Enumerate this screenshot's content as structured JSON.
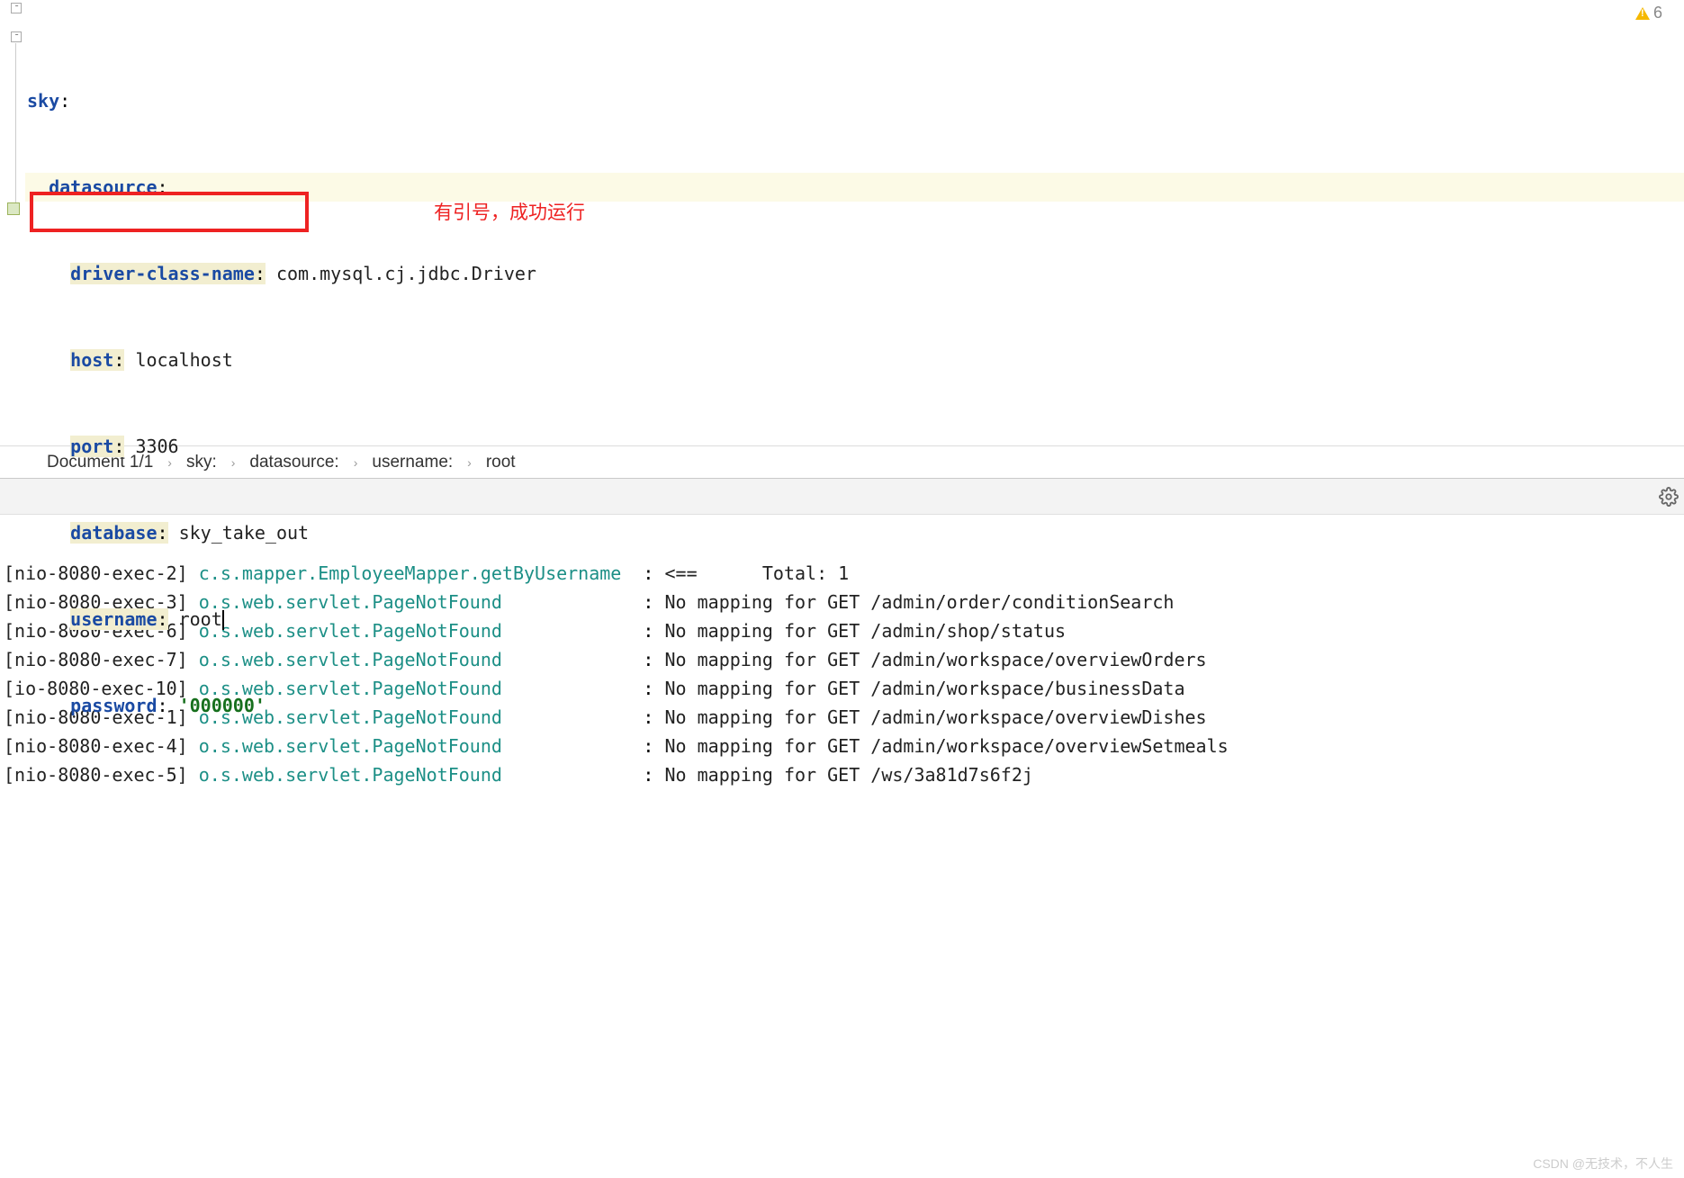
{
  "warning": {
    "count": "6"
  },
  "yaml": {
    "l1": {
      "key": "sky",
      "indent": ""
    },
    "l2": {
      "key": "datasource",
      "indent": "  "
    },
    "l3": {
      "key": "driver-class-name",
      "val": "com.mysql.cj.jdbc.Driver",
      "indent": "    "
    },
    "l4": {
      "key": "host",
      "val": "localhost",
      "indent": "    "
    },
    "l5": {
      "key": "port",
      "val": "3306",
      "indent": "    "
    },
    "l6": {
      "key": "database",
      "val": "sky_take_out",
      "indent": "    "
    },
    "l7": {
      "key": "username",
      "val": "root",
      "indent": "    "
    },
    "l8": {
      "key": "password",
      "val": "'000000'",
      "indent": "    "
    }
  },
  "annotation": "有引号，成功运行",
  "breadcrumb": {
    "doc": "Document 1/1",
    "p1": "sky:",
    "p2": "datasource:",
    "p3": "username:",
    "p4": "root"
  },
  "console": {
    "lines": [
      {
        "thread": "[nio-8080-exec-2]",
        "logger": "c.s.mapper.EmployeeMapper.getByUsername ",
        "sep": " : ",
        "msg": "<==      Total: 1"
      },
      {
        "thread": "[nio-8080-exec-3]",
        "logger": "o.s.web.servlet.PageNotFound            ",
        "sep": " : ",
        "msg": "No mapping for GET /admin/order/conditionSearch"
      },
      {
        "thread": "[nio-8080-exec-6]",
        "logger": "o.s.web.servlet.PageNotFound            ",
        "sep": " : ",
        "msg": "No mapping for GET /admin/shop/status"
      },
      {
        "thread": "[nio-8080-exec-7]",
        "logger": "o.s.web.servlet.PageNotFound            ",
        "sep": " : ",
        "msg": "No mapping for GET /admin/workspace/overviewOrders"
      },
      {
        "thread": "[io-8080-exec-10]",
        "logger": "o.s.web.servlet.PageNotFound            ",
        "sep": " : ",
        "msg": "No mapping for GET /admin/workspace/businessData"
      },
      {
        "thread": "[nio-8080-exec-1]",
        "logger": "o.s.web.servlet.PageNotFound            ",
        "sep": " : ",
        "msg": "No mapping for GET /admin/workspace/overviewDishes"
      },
      {
        "thread": "[nio-8080-exec-4]",
        "logger": "o.s.web.servlet.PageNotFound            ",
        "sep": " : ",
        "msg": "No mapping for GET /admin/workspace/overviewSetmeals"
      },
      {
        "thread": "[nio-8080-exec-5]",
        "logger": "o.s.web.servlet.PageNotFound            ",
        "sep": " : ",
        "msg": "No mapping for GET /ws/3a81d7s6f2j"
      }
    ]
  },
  "watermark": "CSDN @无技术，不人生"
}
